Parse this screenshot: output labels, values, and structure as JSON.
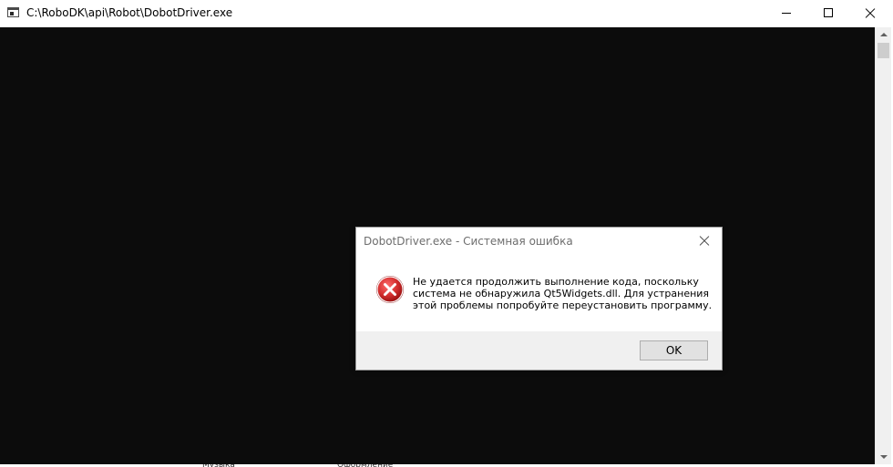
{
  "window": {
    "title": "C:\\RoboDK\\api\\Robot\\DobotDriver.exe",
    "icon": "console-app-icon",
    "controls": {
      "minimize": "minimize-icon",
      "maximize": "maximize-icon",
      "close": "close-icon"
    }
  },
  "console": {
    "background": "#0c0c0c"
  },
  "dialog": {
    "title": "DobotDriver.exe - Системная ошибка",
    "icon": "error-icon",
    "message_lines": [
      "Не удается продолжить выполнение кода, поскольку",
      "система не обнаружила Qt5Widgets.dll. Для устранения",
      "этой проблемы попробуйте переустановить программу."
    ],
    "ok_label": "OK",
    "colors": {
      "error_red": "#d32f2f",
      "footer": "#f0f0f0"
    }
  },
  "taskbar": {
    "items": [
      "Музыка",
      "Оформление"
    ]
  }
}
